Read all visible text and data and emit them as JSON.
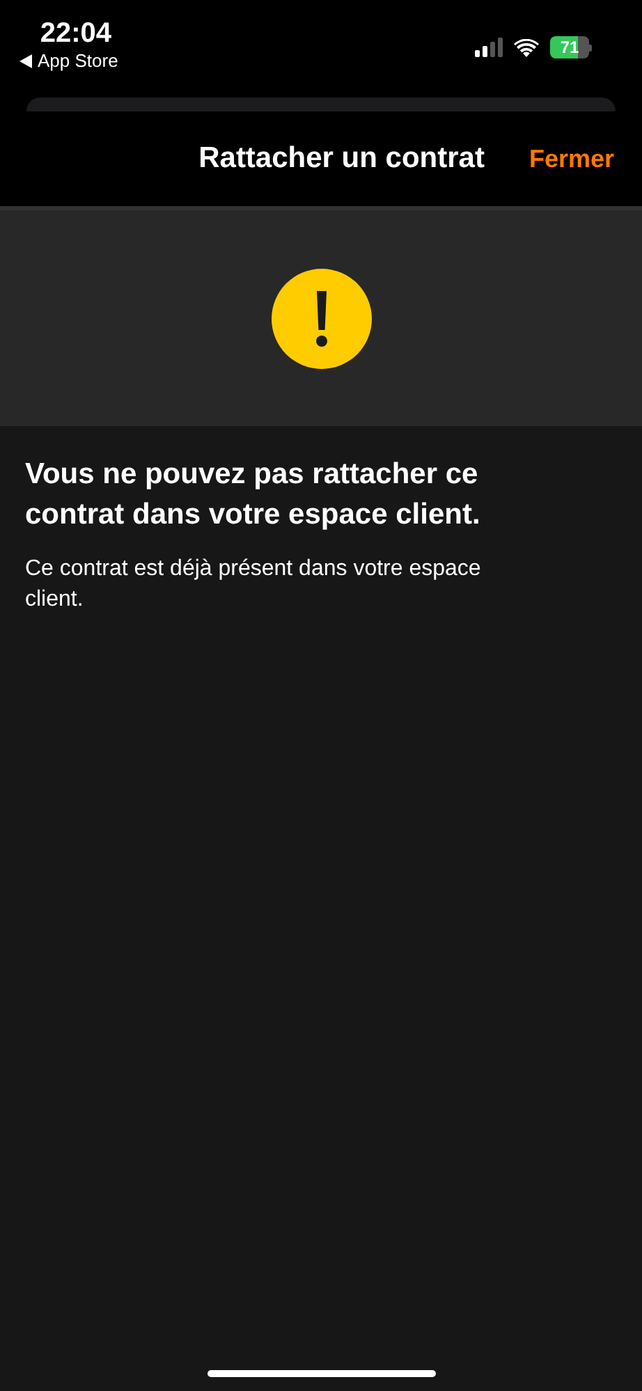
{
  "status_bar": {
    "time": "22:04",
    "back_label": "App Store",
    "battery": "71"
  },
  "nav": {
    "title": "Rattacher un contrat",
    "close": "Fermer"
  },
  "message": {
    "heading": "Vous ne pouvez pas rattacher ce contrat dans votre espace client.",
    "body": "Ce contrat est déjà présent dans votre espace client."
  }
}
